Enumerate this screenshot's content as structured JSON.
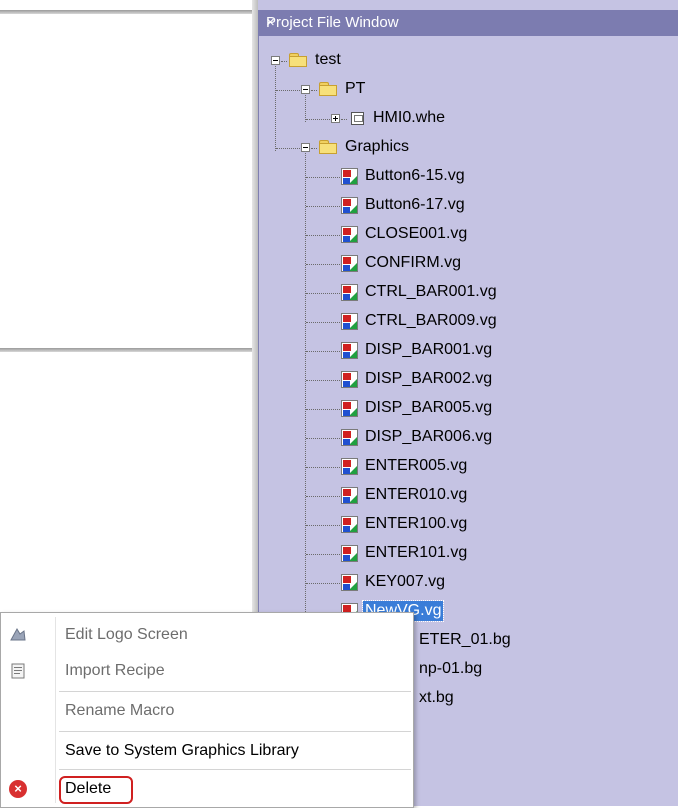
{
  "project_window": {
    "title": "Project File Window",
    "close": "×"
  },
  "tree": {
    "root": "test",
    "pt": "PT",
    "hmi": "HMI0.whe",
    "graphics": "Graphics",
    "files": [
      "Button6-15.vg",
      "Button6-17.vg",
      "CLOSE001.vg",
      "CONFIRM.vg",
      "CTRL_BAR001.vg",
      "CTRL_BAR009.vg",
      "DISP_BAR001.vg",
      "DISP_BAR002.vg",
      "DISP_BAR005.vg",
      "DISP_BAR006.vg",
      "ENTER005.vg",
      "ENTER010.vg",
      "ENTER100.vg",
      "ENTER101.vg",
      "KEY007.vg",
      "NewVG.vg"
    ],
    "bg_files": [
      "ETER_01.bg",
      "np-01.bg",
      "xt.bg"
    ],
    "selected": "NewVG.vg"
  },
  "context_menu": {
    "items": [
      {
        "label": "Edit Logo Screen",
        "enabled": false
      },
      {
        "label": "Import Recipe",
        "enabled": false
      },
      {
        "label": "Rename Macro",
        "enabled": false
      },
      {
        "label": "Save to System Graphics Library",
        "enabled": true
      },
      {
        "label": "Delete",
        "enabled": true,
        "highlighted": true
      }
    ],
    "highlight_color": "#d02020"
  },
  "colors": {
    "panel_bg": "#c5c3e3",
    "title_bar": "#7c7cb0",
    "selection": "#3a7dd8"
  }
}
